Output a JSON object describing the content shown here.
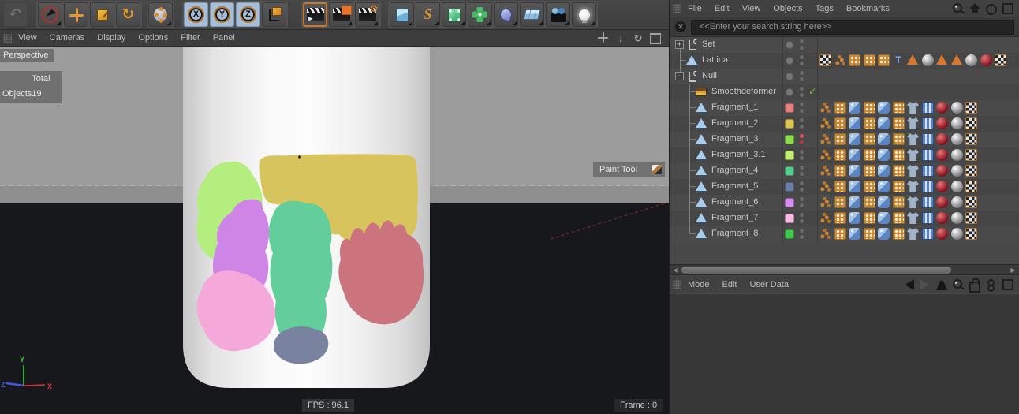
{
  "toolbar": {
    "groups": [
      {
        "buttons": [
          {
            "name": "undo",
            "icon": "undo",
            "glyph": "↶",
            "disabled": true
          }
        ]
      },
      {
        "buttons": [
          {
            "name": "live-selection-tool",
            "icon": "livesel",
            "corner": true
          },
          {
            "name": "move-tool",
            "icon": "move"
          },
          {
            "name": "scale-tool",
            "icon": "scale"
          },
          {
            "name": "rotate-tool",
            "icon": "rotate",
            "glyph": "↻"
          }
        ]
      },
      {
        "buttons": [
          {
            "name": "edit-mode",
            "icon": "editmode",
            "corner": true
          }
        ]
      },
      {
        "buttons": [
          {
            "name": "lock-x-axis",
            "icon": "axis",
            "label": "X",
            "highlight": true
          },
          {
            "name": "lock-y-axis",
            "icon": "axis",
            "label": "Y",
            "highlight": true
          },
          {
            "name": "lock-z-axis",
            "icon": "axis",
            "label": "Z",
            "highlight": true
          },
          {
            "name": "coordinate-system",
            "icon": "coords"
          }
        ]
      },
      {
        "buttons": [
          {
            "name": "render-view",
            "icon": "clapper",
            "selected": true
          },
          {
            "name": "render-to-picture-viewer",
            "icon": "clapper renderpv",
            "corner": true
          },
          {
            "name": "render-settings",
            "icon": "clapper rendergear",
            "corner": true
          }
        ]
      },
      {
        "buttons": [
          {
            "name": "add-primitive",
            "icon": "cube",
            "corner": true
          },
          {
            "name": "add-spline",
            "icon": "spline",
            "glyph": "S",
            "corner": true
          },
          {
            "name": "add-generator",
            "icon": "generator",
            "corner": true
          },
          {
            "name": "add-modeling-object",
            "icon": "modeling",
            "corner": true
          },
          {
            "name": "add-deformer",
            "icon": "deformer",
            "corner": true
          },
          {
            "name": "add-environment",
            "icon": "env",
            "corner": true
          },
          {
            "name": "add-camera",
            "icon": "camera",
            "corner": true
          },
          {
            "name": "add-light",
            "icon": "light",
            "corner": true
          }
        ]
      }
    ]
  },
  "viewport_menu": {
    "items": [
      "View",
      "Cameras",
      "Display",
      "Options",
      "Filter",
      "Panel"
    ],
    "controls": [
      {
        "name": "pan-view",
        "icon": "pan"
      },
      {
        "name": "zoom-view",
        "icon": "vzoom"
      },
      {
        "name": "rotate-view",
        "icon": "vrotate"
      },
      {
        "name": "maximize-view",
        "icon": "vmax"
      }
    ]
  },
  "viewport": {
    "camera_label": "Perspective",
    "hud": {
      "total_label": "Total",
      "objects_label": "Objects",
      "objects_value": "19"
    },
    "paint_tool_label": "Paint Tool",
    "fps": "FPS : 96.1",
    "frame": "Frame : 0",
    "axis": {
      "x": "X",
      "y": "Y",
      "z": "Z"
    }
  },
  "scene": {
    "description": "white cylinder (can) with painted color fragments on gray ground",
    "paint_colors": {
      "yellow": "#d7c45c",
      "lime": "#b4ee7e",
      "teal": "#62ce9b",
      "orchid": "#ce85e6",
      "pink": "#f4a9da",
      "rose": "#cb747d",
      "slate": "#79829f"
    }
  },
  "object_manager": {
    "menu": [
      "File",
      "Edit",
      "View",
      "Objects",
      "Tags",
      "Bookmarks"
    ],
    "menu_icons": [
      {
        "name": "search",
        "icon": "search"
      },
      {
        "name": "home",
        "icon": "home"
      },
      {
        "name": "filter-eye",
        "icon": "eye"
      },
      {
        "name": "new-panel",
        "icon": "plusbox"
      }
    ],
    "search": {
      "placeholder": "<<Enter your search string here>>"
    },
    "tree": [
      {
        "name": "Set",
        "icon": "null",
        "expander": "plus",
        "depth": 0
      },
      {
        "name": "Lattina",
        "icon": "poly",
        "depth": 0,
        "tags": [
          "uvw",
          "phong",
          "sel",
          "sel",
          "sel",
          "stick",
          "tri",
          "matgray",
          "tri",
          "tri",
          "matgray",
          "matred",
          "uvw"
        ]
      },
      {
        "name": "Null",
        "icon": "null",
        "expander": "minus",
        "depth": 0
      },
      {
        "name": "Smoothdeformer",
        "icon": "sdef",
        "depth": 1,
        "check": true
      },
      {
        "name": "Fragment_1",
        "icon": "poly",
        "depth": 1,
        "chip": "#e4807c",
        "tags": [
          "phong",
          "sel",
          "python",
          "sel",
          "python",
          "sel",
          "cloth",
          "comp",
          "matred",
          "matgray",
          "uvw"
        ]
      },
      {
        "name": "Fragment_2",
        "icon": "poly",
        "depth": 1,
        "chip": "#dcc453",
        "tags": [
          "phong",
          "sel",
          "python",
          "sel",
          "python",
          "sel",
          "cloth",
          "comp",
          "matred",
          "matgray",
          "uvw"
        ]
      },
      {
        "name": "Fragment_3",
        "icon": "poly",
        "depth": 1,
        "chip": "#8edd4e",
        "dots": "red",
        "tags": [
          "phong",
          "sel",
          "python",
          "sel",
          "python",
          "sel",
          "cloth",
          "comp",
          "matred",
          "matgray",
          "uvw"
        ]
      },
      {
        "name": "Fragment_3.1",
        "icon": "poly",
        "depth": 1,
        "chip": "#c2ee74",
        "tags": [
          "phong",
          "sel",
          "python",
          "sel",
          "python",
          "sel",
          "cloth",
          "comp",
          "matred",
          "matgray",
          "uvw"
        ]
      },
      {
        "name": "Fragment_4",
        "icon": "poly",
        "depth": 1,
        "chip": "#55cd8c",
        "tags": [
          "phong",
          "sel",
          "python",
          "sel",
          "python",
          "sel",
          "cloth",
          "comp",
          "matred",
          "matgray",
          "uvw"
        ]
      },
      {
        "name": "Fragment_5",
        "icon": "poly",
        "depth": 1,
        "chip": "#6b7ea9",
        "tags": [
          "phong",
          "sel",
          "python",
          "sel",
          "python",
          "sel",
          "cloth",
          "comp",
          "matred",
          "matgray",
          "uvw"
        ]
      },
      {
        "name": "Fragment_6",
        "icon": "poly",
        "depth": 1,
        "chip": "#d88ef0",
        "tags": [
          "phong",
          "sel",
          "python",
          "sel",
          "python",
          "sel",
          "cloth",
          "comp",
          "matred",
          "matgray",
          "uvw"
        ]
      },
      {
        "name": "Fragment_7",
        "icon": "poly",
        "depth": 1,
        "chip": "#f8bbe5",
        "tags": [
          "phong",
          "sel",
          "python",
          "sel",
          "python",
          "sel",
          "cloth",
          "comp",
          "matred",
          "matgray",
          "uvw"
        ]
      },
      {
        "name": "Fragment_8",
        "icon": "poly",
        "depth": 1,
        "chip": "#44c74f",
        "tags": [
          "phong",
          "sel",
          "python",
          "sel",
          "python",
          "sel",
          "cloth",
          "comp",
          "matred",
          "matgray",
          "uvw"
        ]
      }
    ]
  },
  "attribute_manager": {
    "menu": [
      "Mode",
      "Edit",
      "User Data"
    ],
    "icons": [
      {
        "name": "history-back",
        "icon": "back"
      },
      {
        "name": "history-forward",
        "icon": "fwd"
      },
      {
        "name": "arrow-mode",
        "icon": "cursorA"
      },
      {
        "name": "search",
        "icon": "search"
      },
      {
        "name": "lock",
        "icon": "lock"
      },
      {
        "name": "snapshot",
        "icon": "hist"
      },
      {
        "name": "new-panel",
        "icon": "plusbox"
      }
    ]
  }
}
